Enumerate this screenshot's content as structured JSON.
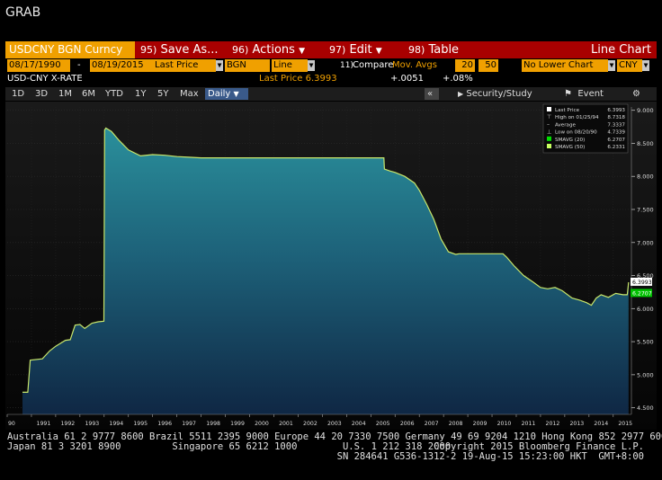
{
  "window": {
    "title": "GRAB"
  },
  "toolbar": {
    "ticker": "USDCNY BGN Curncy",
    "save_num": "95)",
    "save_label": "Save As...",
    "actions_num": "96)",
    "actions_label": "Actions",
    "edit_num": "97)",
    "edit_label": "Edit",
    "table_num": "98)",
    "table_label": "Table",
    "mode": "Line Chart"
  },
  "options": {
    "start_date": "08/17/1990",
    "sep": "-",
    "end_date": "08/19/2015",
    "price_field": "Last Price",
    "source": "BGN",
    "style": "Line",
    "compare_num": "11)",
    "compare_label": "Compare",
    "compare_value": "Mov. Avgs",
    "ma1": "20",
    "ma2": "50",
    "lower_chart": "No Lower Chart",
    "currency": "CNY"
  },
  "info": {
    "name": "USD-CNY X-RATE",
    "last_price_label": "Last Price 6.3993",
    "change": "+.0051",
    "change_pct": "+.08%"
  },
  "ranges": {
    "items": [
      "1D",
      "3D",
      "1M",
      "6M",
      "YTD",
      "1Y",
      "5Y",
      "Max"
    ],
    "frequency": "Daily",
    "collapse": "«",
    "security_label": "Security/Study",
    "event_label": "Event"
  },
  "legend": [
    {
      "label": "Last Price",
      "value": "6.3993"
    },
    {
      "label": "High on 01/25/94",
      "value": "8.7318"
    },
    {
      "label": "Average",
      "value": "7.3337"
    },
    {
      "label": "Low on 08/20/90",
      "value": "4.7339"
    },
    {
      "label": "SMAVG (20)",
      "value": "6.2707"
    },
    {
      "label": "SMAVG (50)",
      "value": "6.2331"
    }
  ],
  "badges": {
    "last": "6.3993",
    "smavg": "6.2707"
  },
  "colors": {
    "accent": "#f0a000",
    "menu": "#a80000",
    "price_line": "#c8e66b",
    "sma20": "#00e000",
    "sma50": "#c8ff60",
    "fill_top": "#2a8f9b",
    "fill_bottom": "#0f2744"
  },
  "chart_data": {
    "type": "area",
    "title": "",
    "xlabel": "",
    "ylabel": "",
    "ylim": [
      4.4,
      9.05
    ],
    "xlim": [
      1990.0,
      2015.75
    ],
    "x_ticks": [
      "90",
      "1991",
      "1992",
      "1993",
      "1994",
      "1995",
      "1996",
      "1997",
      "1998",
      "1999",
      "2000",
      "2001",
      "2002",
      "2003",
      "2004",
      "2005",
      "2006",
      "2007",
      "2008",
      "2009",
      "2010",
      "2011",
      "2012",
      "2013",
      "2014",
      "2015"
    ],
    "y_ticks": [
      "9.000",
      "8.500",
      "8.000",
      "7.500",
      "7.000",
      "6.500",
      "6.000",
      "5.500",
      "5.000",
      "4.500"
    ],
    "grid": true,
    "legend_position": "top-right",
    "series": [
      {
        "name": "Last Price",
        "x": [
          1990.63,
          1990.85,
          1990.95,
          1991.45,
          1991.75,
          1992.0,
          1992.4,
          1992.6,
          1992.8,
          1993.0,
          1993.2,
          1993.5,
          1993.75,
          1993.99,
          1994.02,
          1994.07,
          1994.3,
          1994.6,
          1995.0,
          1995.5,
          1996.0,
          1996.5,
          1997.0,
          1997.5,
          1998.0,
          2000.0,
          2002.0,
          2004.0,
          2005.54,
          2005.56,
          2005.8,
          2006.0,
          2006.4,
          2006.8,
          2007.0,
          2007.3,
          2007.6,
          2007.9,
          2008.2,
          2008.5,
          2008.65,
          2009.0,
          2009.5,
          2010.0,
          2010.45,
          2010.6,
          2010.9,
          2011.3,
          2011.7,
          2012.0,
          2012.3,
          2012.6,
          2012.9,
          2013.3,
          2013.6,
          2013.9,
          2014.1,
          2014.3,
          2014.5,
          2014.8,
          2015.1,
          2015.4,
          2015.58,
          2015.62,
          2015.63
        ],
        "y": [
          4.734,
          4.734,
          5.22,
          5.24,
          5.36,
          5.43,
          5.52,
          5.53,
          5.75,
          5.76,
          5.7,
          5.78,
          5.8,
          5.81,
          8.7,
          8.73,
          8.68,
          8.55,
          8.4,
          8.31,
          8.33,
          8.32,
          8.3,
          8.29,
          8.28,
          8.28,
          8.28,
          8.28,
          8.28,
          8.11,
          8.08,
          8.06,
          8.0,
          7.9,
          7.79,
          7.58,
          7.35,
          7.05,
          6.86,
          6.82,
          6.83,
          6.83,
          6.83,
          6.83,
          6.83,
          6.78,
          6.65,
          6.5,
          6.4,
          6.32,
          6.3,
          6.32,
          6.27,
          6.16,
          6.13,
          6.09,
          6.05,
          6.16,
          6.21,
          6.17,
          6.23,
          6.21,
          6.21,
          6.35,
          6.3993
        ]
      },
      {
        "name": "SMAVG (20)",
        "x": [
          2015.63
        ],
        "y": [
          6.2707
        ]
      },
      {
        "name": "SMAVG (50)",
        "x": [
          2015.63
        ],
        "y": [
          6.2331
        ]
      }
    ]
  },
  "footer": {
    "line1": "Australia 61 2 9777 8600 Brazil 5511 2395 9000 Europe 44 20 7330 7500 Germany 49 69 9204 1210 Hong Kong 852 2977 6000",
    "line2_left": "Japan 81 3 3201 8900         Singapore 65 6212 1000        U.S. 1 212 318 2000",
    "line2_right": "Copyright 2015 Bloomberg Finance L.P.",
    "line3": "SN 284641 G536-1312-2 19-Aug-15 15:23:00 HKT  GMT+8:00"
  }
}
